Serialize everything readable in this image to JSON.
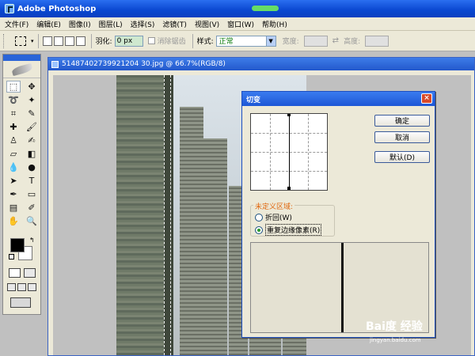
{
  "app": {
    "title": "Adobe Photoshop"
  },
  "menu": [
    "文件(F)",
    "编辑(E)",
    "图像(I)",
    "图层(L)",
    "选择(S)",
    "滤镜(T)",
    "视图(V)",
    "窗口(W)",
    "帮助(H)"
  ],
  "options": {
    "feather_label": "羽化:",
    "feather_value": "0 px",
    "antialias_label": "消除锯齿",
    "style_label": "样式:",
    "style_value": "正常",
    "width_label": "宽度:",
    "height_label": "高度:"
  },
  "document": {
    "title": "51487402739921204 30.jpg @ 66.7%(RGB/8)"
  },
  "dialog": {
    "title": "切变",
    "ok_label": "确定",
    "cancel_label": "取消",
    "default_label": "默认(D)",
    "undefined_area_label": "未定义区域:",
    "wrap_label": "折回(W)",
    "repeat_label": "重复边缘像素(R)",
    "close_glyph": "×"
  },
  "watermark": {
    "brand": "Bai度 经验",
    "url": "jingyan.baidu.com"
  },
  "colors": {
    "title_blue": "#0a47d0",
    "dialog_bg": "#ece9d8",
    "group_label": "#e06810"
  }
}
